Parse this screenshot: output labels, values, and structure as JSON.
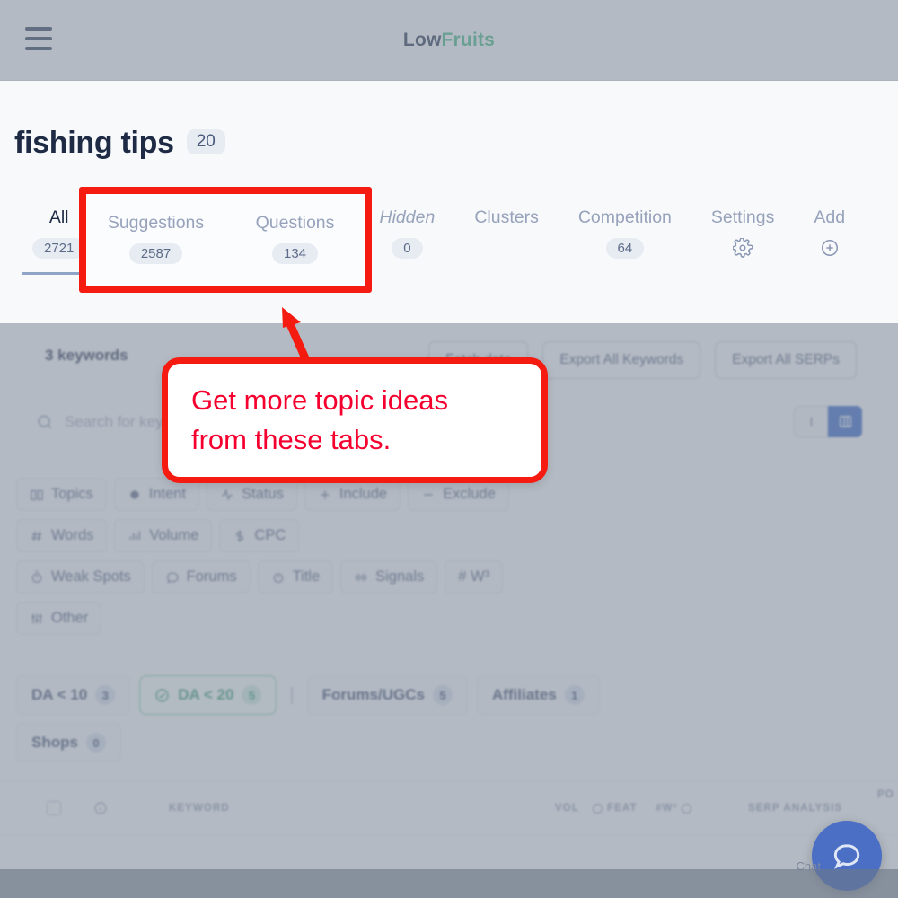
{
  "header": {
    "menu_icon": "hamburger-icon",
    "brand_first": "Low",
    "brand_second": "Fruits"
  },
  "page": {
    "title": "fishing tips",
    "title_badge": "20"
  },
  "tabs": [
    {
      "label": "All",
      "badge": "2721",
      "active": true,
      "italic": false
    },
    {
      "label": "Suggestions",
      "badge": "2587",
      "active": false,
      "italic": false
    },
    {
      "label": "Questions",
      "badge": "134",
      "active": false,
      "italic": false
    },
    {
      "label": "Hidden",
      "badge": "0",
      "active": false,
      "italic": true
    },
    {
      "label": "Clusters",
      "badge": "",
      "active": false,
      "italic": false
    },
    {
      "label": "Competition",
      "badge": "64",
      "active": false,
      "italic": false
    },
    {
      "label": "Settings",
      "icon": "gear-icon",
      "active": false,
      "italic": false
    },
    {
      "label": "Add",
      "icon": "plus-circle-icon",
      "active": false,
      "italic": false
    }
  ],
  "highlight": {
    "tab_1_label": "Suggestions",
    "tab_1_badge": "2587",
    "tab_2_label": "Questions",
    "tab_2_badge": "134",
    "border_color": "#f51b10"
  },
  "callout": {
    "line1": "Get more topic ideas",
    "line2": "from these tabs.",
    "color": "#f5002e"
  },
  "toolbar": {
    "keyword_count": "3 keywords",
    "fetch_button": "Fetch data",
    "export_keywords_button": "Export All Keywords",
    "export_serps_button": "Export All SERPs"
  },
  "search": {
    "icon": "search-icon",
    "placeholder": "Search for keywords"
  },
  "view_toggle": {
    "list_icon": "list-view-icon",
    "grid_icon": "grid-view-icon",
    "active": "grid"
  },
  "filter_chips": [
    [
      {
        "label": "Topics",
        "icon": "book-icon"
      },
      {
        "label": "Intent",
        "icon": "circle-filled-icon"
      },
      {
        "label": "Status",
        "icon": "pulse-icon"
      },
      {
        "label": "Include",
        "icon": "plus-icon"
      },
      {
        "label": "Exclude",
        "icon": "minus-icon"
      }
    ],
    [
      {
        "label": "Words",
        "icon": "hash-icon"
      },
      {
        "label": "Volume",
        "icon": "bars-icon"
      },
      {
        "label": "CPC",
        "icon": "dollar-icon"
      }
    ],
    [
      {
        "label": "Weak Spots",
        "icon": "stopwatch-icon"
      },
      {
        "label": "Forums",
        "icon": "comment-icon"
      },
      {
        "label": "Title",
        "icon": "clock-icon"
      },
      {
        "label": "Signals",
        "icon": "signal-icon"
      },
      {
        "label": "# W³",
        "icon": "hash-icon"
      }
    ],
    [
      {
        "label": "Other",
        "icon": "sliders-icon"
      }
    ]
  ],
  "filter_pills": [
    [
      {
        "label": "DA < 10",
        "count": "3",
        "green": false,
        "sep_after": false
      },
      {
        "label": "DA < 20",
        "count": "5",
        "green": true,
        "sep_after": true
      },
      {
        "label": "Forums/UGCs",
        "count": "5",
        "green": false,
        "sep_after": false
      },
      {
        "label": "Affiliates",
        "count": "1",
        "green": false,
        "sep_after": false
      }
    ],
    [
      {
        "label": "Shops",
        "count": "0",
        "green": false,
        "sep_after": false
      }
    ]
  ],
  "table_headers": {
    "keyword": "KEYWORD",
    "vol": "VOL",
    "feat": "FEAT",
    "w3": "#W³",
    "serp_analysis": "SERP ANALYSIS",
    "position": "PO"
  },
  "chat": {
    "icon": "chat-bubble-icon",
    "label": "Chat"
  }
}
